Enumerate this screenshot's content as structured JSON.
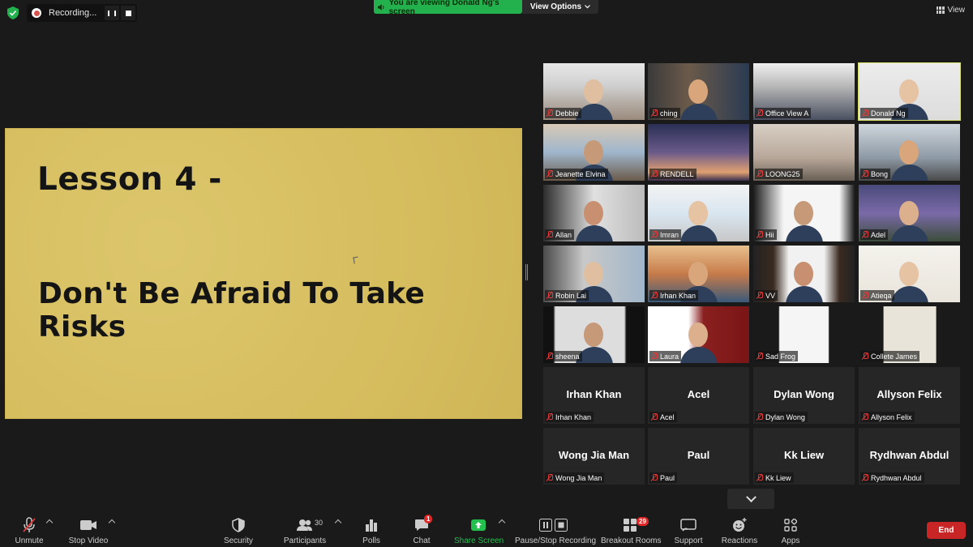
{
  "top": {
    "recording_label": "Recording...",
    "viewing_text": "You are viewing Donald Ng's screen",
    "view_options": "View Options",
    "view": "View"
  },
  "slide": {
    "title": "Lesson 4 -",
    "subtitle": "Don't Be Afraid To Take Risks"
  },
  "participants": [
    {
      "name": "Debbie"
    },
    {
      "name": "ching"
    },
    {
      "name": "Office View A"
    },
    {
      "name": "Donald Ng"
    },
    {
      "name": "Jeanette Elvina"
    },
    {
      "name": "RENDELL"
    },
    {
      "name": "LOONG25"
    },
    {
      "name": "Bong"
    },
    {
      "name": "Allan"
    },
    {
      "name": "Imran"
    },
    {
      "name": "Hii"
    },
    {
      "name": "Adel"
    },
    {
      "name": "Robin Lai"
    },
    {
      "name": "Irhan Khan"
    },
    {
      "name": "VV"
    },
    {
      "name": "Atieqa"
    },
    {
      "name": "sheena"
    },
    {
      "name": "Laura"
    },
    {
      "name": "Sad Frog"
    },
    {
      "name": "Collete James"
    },
    {
      "name": "Irhan Khan",
      "big": "Irhan Khan"
    },
    {
      "name": "Acel",
      "big": "Acel"
    },
    {
      "name": "Dylan Wong",
      "big": "Dylan Wong"
    },
    {
      "name": "Allyson Felix",
      "big": "Allyson Felix"
    },
    {
      "name": "Wong Jia Man",
      "big": "Wong Jia Man"
    },
    {
      "name": "Paul",
      "big": "Paul"
    },
    {
      "name": "Kk Liew",
      "big": "Kk Liew"
    },
    {
      "name": "Rydhwan Abdul",
      "big": "Rydhwan Abdul"
    }
  ],
  "toolbar": {
    "unmute": "Unmute",
    "stop_video": "Stop Video",
    "security": "Security",
    "participants": "Participants",
    "participants_count": "30",
    "polls": "Polls",
    "chat": "Chat",
    "chat_badge": "1",
    "share_screen": "Share Screen",
    "pause_stop_recording": "Pause/Stop Recording",
    "breakout_rooms": "Breakout Rooms",
    "breakout_badge": "29",
    "support": "Support",
    "reactions": "Reactions",
    "apps": "Apps",
    "end": "End"
  },
  "colors": {
    "accent_green": "#23b14d",
    "end_red": "#c82626",
    "active_outline": "#d8e06a",
    "slide_bg": "#d9c267"
  }
}
